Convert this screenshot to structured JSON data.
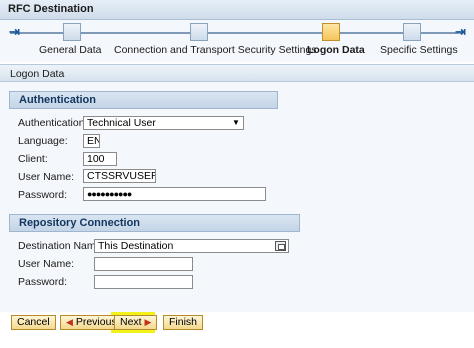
{
  "window": {
    "title": "RFC Destination"
  },
  "roadmap": {
    "steps": [
      {
        "label": "General Data"
      },
      {
        "label": "Connection and Transport Security Settings"
      },
      {
        "label": "Logon Data"
      },
      {
        "label": "Specific Settings"
      }
    ],
    "active_step": "Logon Data"
  },
  "section": {
    "title": "Logon Data"
  },
  "authentication": {
    "header": "Authentication",
    "fields": {
      "authentication": {
        "label": "Authentication:",
        "value": "Technical User"
      },
      "language": {
        "label": "Language:",
        "value": "EN"
      },
      "client": {
        "label": "Client:",
        "value": "100"
      },
      "user_name": {
        "label": "User Name:",
        "value": "CTSSRVUSER"
      },
      "password": {
        "label": "Password:",
        "value": "●●●●●●●●●●"
      }
    }
  },
  "repository": {
    "header": "Repository Connection",
    "fields": {
      "destination_name": {
        "label": "Destination Name:",
        "value": "This Destination"
      },
      "user_name": {
        "label": "User Name:",
        "value": ""
      },
      "password": {
        "label": "Password:",
        "value": ""
      }
    }
  },
  "footer": {
    "cancel": "Cancel",
    "previous": "Previous",
    "next": "Next",
    "finish": "Finish"
  },
  "colors": {
    "active_step": "#f5c55c",
    "highlight": "#f2f21a",
    "header_text": "#12365f"
  }
}
